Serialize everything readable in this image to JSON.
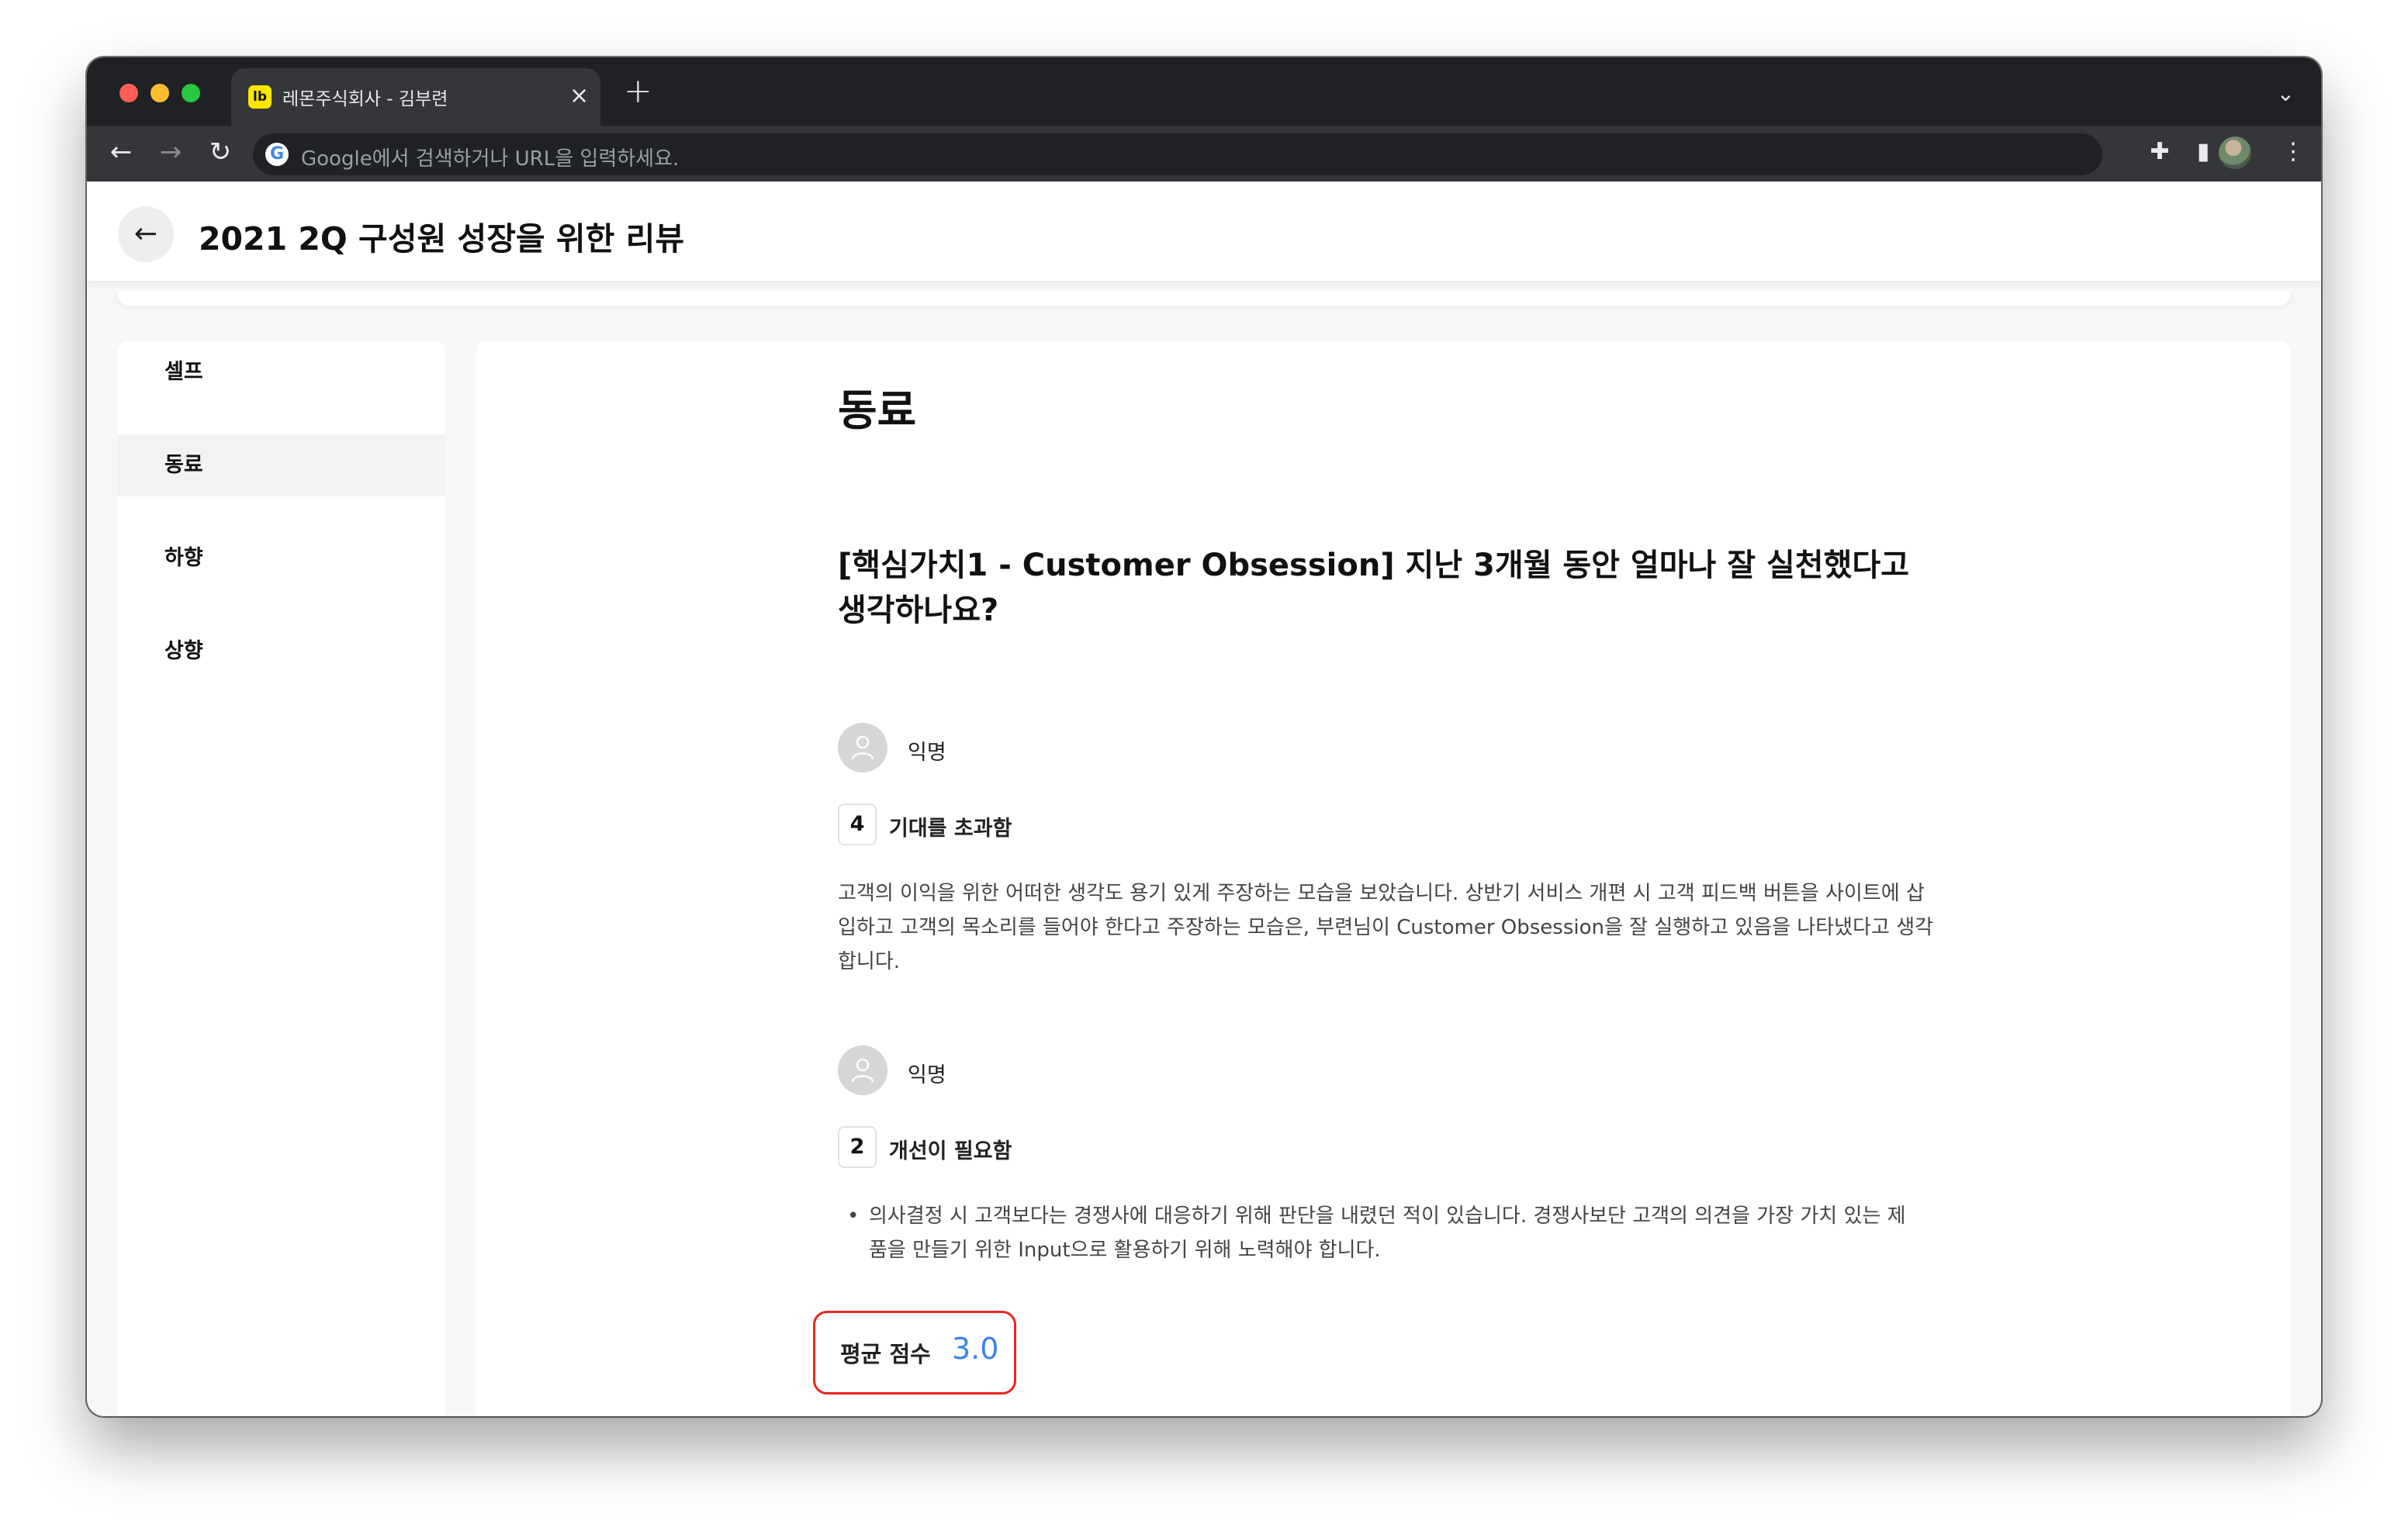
{
  "browser": {
    "tab": {
      "favicon_text": "lb",
      "title": "레몬주식회사 - 김부련",
      "close_icon": "×"
    },
    "new_tab_icon": "+",
    "tab_menu_icon": "⌄",
    "nav": {
      "back": "←",
      "forward": "→",
      "reload": "↻"
    },
    "omnibox": {
      "google_icon": "G",
      "placeholder": "Google에서 검색하거나 URL을 입력하세요."
    },
    "toolbar_icons": {
      "extensions": "✚",
      "sidepanel": "▮",
      "menu": "⋮"
    }
  },
  "page": {
    "back_icon": "←",
    "title": "2021 2Q 구성원 성장을 위한 리뷰"
  },
  "sidebar": {
    "items": [
      {
        "label": "셀프"
      },
      {
        "label": "동료",
        "active": true
      },
      {
        "label": "하향"
      },
      {
        "label": "상향"
      }
    ]
  },
  "main": {
    "section_title": "동료",
    "question": "[핵심가치1 - Customer Obsession] 지난 3개월 동안 얼마나 잘 실천했다고 생각하나요?",
    "responses": [
      {
        "author": "익명",
        "score": "4",
        "score_label": "기대를 초과함",
        "comment": "고객의 이익을 위한 어떠한 생각도 용기 있게 주장하는 모습을 보았습니다. 상반기 서비스 개편 시 고객 피드백 버튼을 사이트에 삽입하고 고객의 목소리를 들어야 한다고 주장하는 모습은, 부련님이 Customer Obsession을 잘 실행하고 있음을 나타냈다고 생각합니다."
      },
      {
        "author": "익명",
        "score": "2",
        "score_label": "개선이 필요함",
        "bullet": "•",
        "comment": "의사결정 시 고객보다는 경쟁사에 대응하기 위해 판단을 내렸던 적이 있습니다. 경쟁사보단 고객의 의견을 가장 가치 있는 제품을 만들기 위한 Input으로 활용하기 위해 노력해야 합니다."
      }
    ],
    "average": {
      "label": "평균 점수",
      "value": "3.0"
    }
  },
  "colors": {
    "accent_blue": "#3b82f6",
    "highlight_red": "#e8271e",
    "favicon_yellow": "#ffe600"
  }
}
